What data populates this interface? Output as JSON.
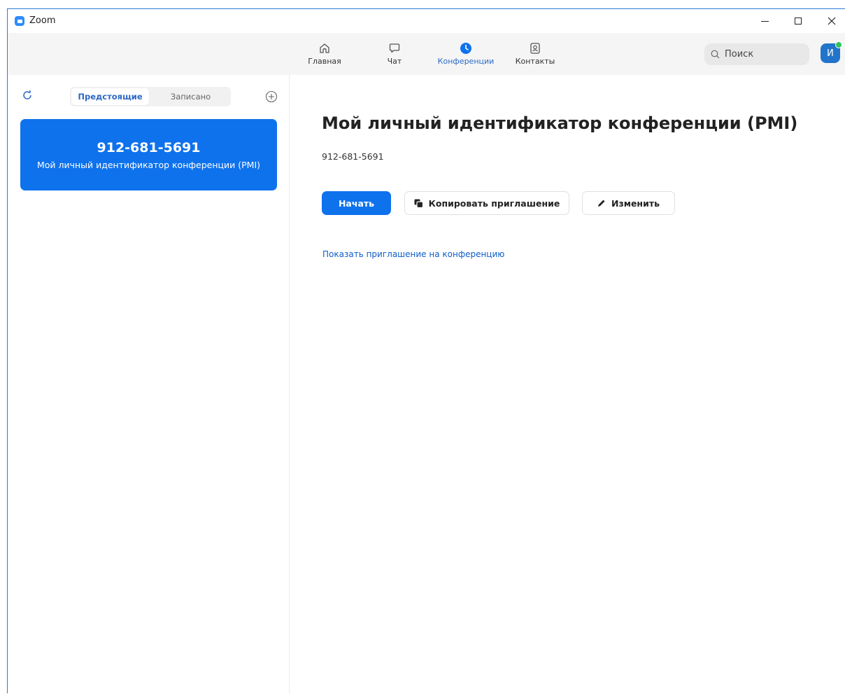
{
  "window": {
    "title": "Zoom"
  },
  "nav": {
    "tabs": [
      {
        "label": "Главная",
        "icon": "home-icon"
      },
      {
        "label": "Чат",
        "icon": "chat-icon"
      },
      {
        "label": "Конференции",
        "icon": "clock-icon",
        "active": true
      },
      {
        "label": "Контакты",
        "icon": "contacts-icon"
      }
    ],
    "search_label": "Поиск",
    "avatar_initial": "И",
    "presence_color": "#2ec25f"
  },
  "meetings": {
    "tabs": [
      {
        "label": "Предстоящие",
        "active": true
      },
      {
        "label": "Записано"
      }
    ],
    "pmi_card": {
      "number": "912-681-5691",
      "label": "Мой личный идентификатор конференции (PMI)"
    }
  },
  "detail": {
    "title": "Мой личный идентификатор конференции (PMI)",
    "number": "912-681-5691",
    "start_label": "Начать",
    "copy_label": "Копировать приглашение",
    "edit_label": "Изменить",
    "show_invite_link": "Показать приглашение на конференцию"
  },
  "colors": {
    "accent": "#0e72ed",
    "link": "#0e5ec9",
    "active_tab": "#2d68c4"
  }
}
